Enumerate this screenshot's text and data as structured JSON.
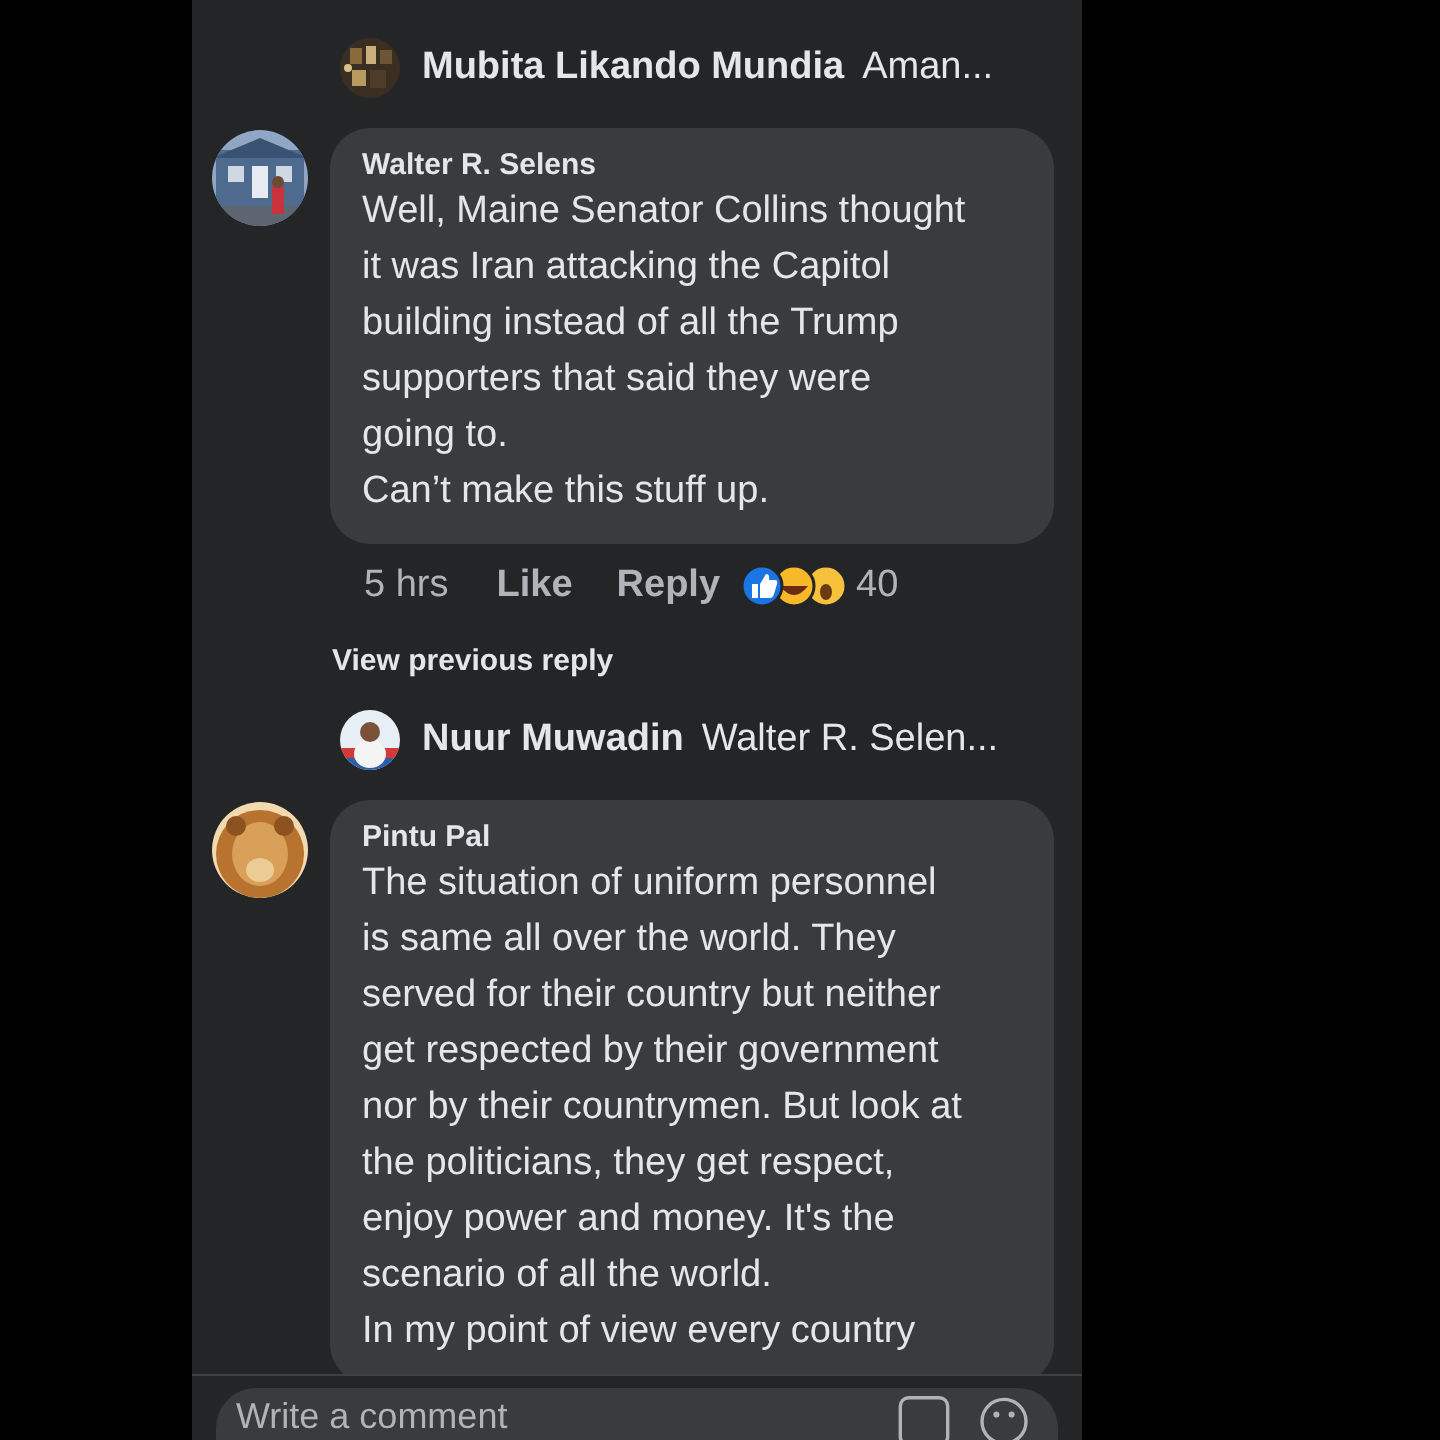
{
  "thread": [
    {
      "kind": "reply_preview",
      "author": "Mubita Likando Mundia",
      "preview": "Aman..."
    },
    {
      "kind": "comment",
      "author": "Walter R. Selens",
      "text": "Well, Maine Senator Collins thought\nit was Iran attacking the Capitol\nbuilding instead of all the Trump\nsupporters that said they were\ngoing to.\nCan’t make this stuff up.",
      "time": "5 hrs",
      "actions": [
        "Like",
        "Reply"
      ],
      "reaction_count": "40"
    },
    {
      "kind": "view_more",
      "label": "View previous reply"
    },
    {
      "kind": "reply_preview",
      "author": "Nuur Muwadin",
      "preview": "Walter R. Selen..."
    },
    {
      "kind": "comment",
      "author": "Pintu Pal",
      "text": "The situation of uniform personnel\nis same all over the world. They\nserved for their country but neither\nget respected by their government\nnor by their countrymen. But look at\nthe politicians, they get respect,\nenjoy power and money. It's the\nscenario of all the world.\nIn my point of view every country"
    }
  ],
  "composer": {
    "placeholder": "Write a comment"
  }
}
